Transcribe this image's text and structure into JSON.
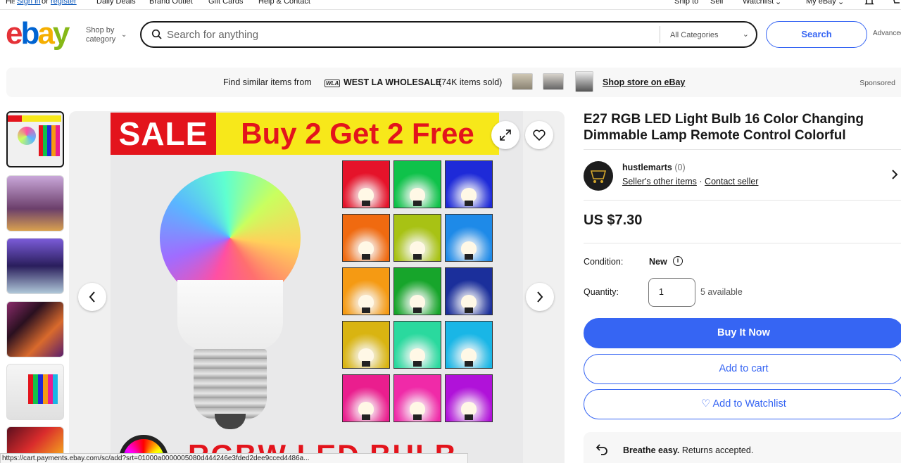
{
  "topnav": {
    "greeting": "Hi!",
    "sign_in": "Sign in",
    "or": "or",
    "register": "register",
    "daily_deals": "Daily Deals",
    "brand_outlet": "Brand Outlet",
    "gift_cards": "Gift Cards",
    "help_contact": "Help & Contact",
    "ship_to": "Ship to",
    "sell": "Sell",
    "watchlist": "Watchlist",
    "my_ebay": "My eBay"
  },
  "header": {
    "logo": "ebay",
    "shop_by_category_line1": "Shop by",
    "shop_by_category_line2": "category",
    "search_placeholder": "Search for anything",
    "category_select": "All Categories",
    "search_button": "Search",
    "advanced": "Advanced"
  },
  "banner": {
    "find_similar": "Find similar items from",
    "store_logo": "WLA",
    "store_name": "WEST LA WHOLESALE",
    "items_sold": "(74K items sold)",
    "shop_store": "Shop store on eBay",
    "sponsored": "Sponsored"
  },
  "gallery": {
    "sale_text": "SALE",
    "promo_text": "Buy 2 Get 2 Free",
    "bottom_text": "RGBW LED BULB",
    "thumb_count": 6,
    "selected_thumb": 1
  },
  "product": {
    "title": "E27 RGB LED Light Bulb 16 Color Changing Dimmable Lamp Remote Control Colorful",
    "seller_name": "hustlemarts",
    "seller_feedback": "(0)",
    "seller_other_items": "Seller's other items",
    "contact_seller": "Contact seller",
    "price": "US $7.30",
    "condition_label": "Condition:",
    "condition_value": "New",
    "quantity_label": "Quantity:",
    "quantity_value": "1",
    "available": "5 available",
    "buy_it_now": "Buy It Now",
    "add_to_cart": "Add to cart",
    "add_to_watchlist": "♡ Add to Watchlist",
    "breathe_easy": "Breathe easy.",
    "returns": "Returns accepted."
  },
  "status_bar": {
    "url": "https://cart.payments.ebay.com/sc/add?srt=01000a0000005080d444246e3fded2dee9cced4486a..."
  },
  "colors": {
    "ebay_red": "#e53238",
    "ebay_blue": "#0064d2",
    "ebay_yellow": "#f5af02",
    "ebay_green": "#86b817",
    "primary_button": "#3665f3"
  },
  "grid_colors": [
    "#e5132a",
    "#0fc24a",
    "#1e2ad8",
    "#f06a10",
    "#a8c214",
    "#1e8ae8",
    "#f59a13",
    "#17a52b",
    "#1b2f9b",
    "#d9b411",
    "#2ad99e",
    "#19b6e6",
    "#ea1e8e",
    "#f02aa8",
    "#b012d9"
  ]
}
